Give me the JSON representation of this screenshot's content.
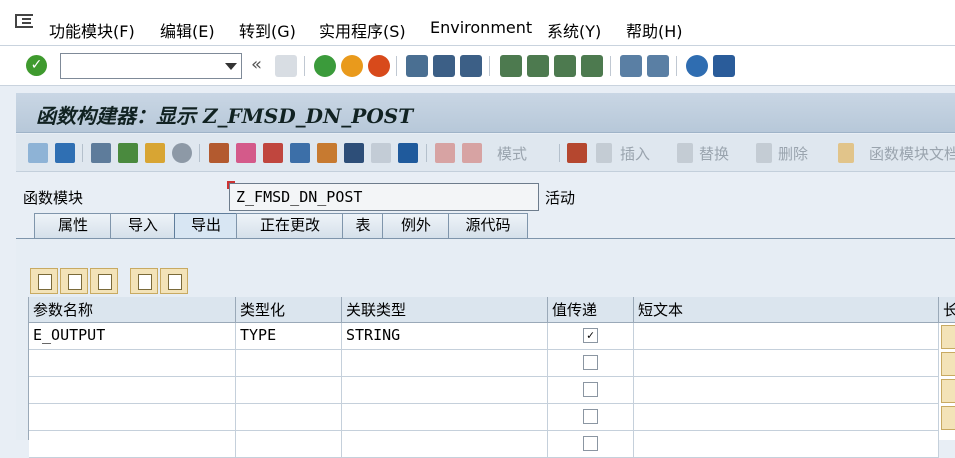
{
  "menu": [
    "功能模块(F)",
    "编辑(E)",
    "转到(G)",
    "实用程序(S)",
    "Environment",
    "系统(Y)",
    "帮助(H)"
  ],
  "toolbar": {
    "command_value": "",
    "back_label": "«"
  },
  "title": "函数构建器：显示 Z_FMSD_DN_POST",
  "app_toolbar": {
    "mode": "模式",
    "insert": "插入",
    "replace": "替换",
    "delete": "删除",
    "fm_doc": "函数模块文档"
  },
  "form": {
    "label": "函数模块",
    "value": "Z_FMSD_DN_POST",
    "status": "活动"
  },
  "tabs": [
    "属性",
    "导入",
    "导出",
    "正在更改",
    "表",
    "例外",
    "源代码"
  ],
  "table": {
    "columns": [
      "参数名称",
      "类型化",
      "关联类型",
      "值传递",
      "短文本",
      "长"
    ],
    "rows": [
      {
        "name": "E_OUTPUT",
        "typing": "TYPE",
        "ref_type": "STRING",
        "pass_by_value": true,
        "short_text": ""
      },
      {
        "name": "",
        "typing": "",
        "ref_type": "",
        "pass_by_value": false,
        "short_text": ""
      },
      {
        "name": "",
        "typing": "",
        "ref_type": "",
        "pass_by_value": false,
        "short_text": ""
      },
      {
        "name": "",
        "typing": "",
        "ref_type": "",
        "pass_by_value": false,
        "short_text": ""
      },
      {
        "name": "",
        "typing": "",
        "ref_type": "",
        "pass_by_value": false,
        "short_text": ""
      }
    ]
  },
  "colors": {
    "title_band": "#c3d2e2",
    "ok_green": "#3f9a2e",
    "edit_button": "#f3e3b8"
  }
}
